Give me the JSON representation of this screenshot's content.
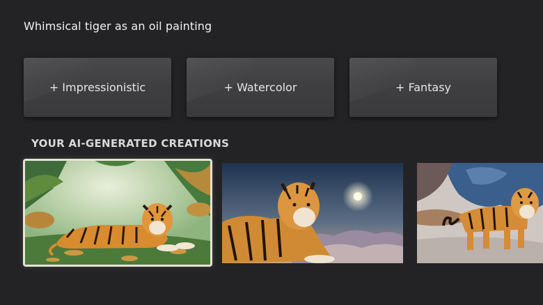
{
  "prompt": {
    "text": "Whimsical tiger as an oil painting"
  },
  "style_chips": [
    {
      "label": "+ Impressionistic"
    },
    {
      "label": "+ Watercolor"
    },
    {
      "label": "+ Fantasy"
    }
  ],
  "creations": {
    "heading": "YOUR AI-GENERATED CREATIONS"
  },
  "colors": {
    "background": "#232325",
    "chip": "#404042",
    "focus_border": "#e7e2d6"
  }
}
